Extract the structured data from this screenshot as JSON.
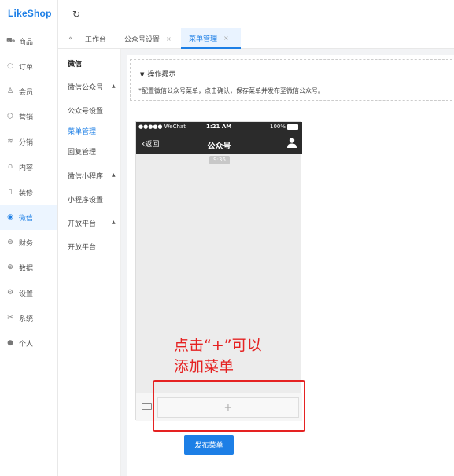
{
  "app": {
    "logo": "LikeShop"
  },
  "sidebar": {
    "items": [
      {
        "label": "商品",
        "icon": "cart-icon"
      },
      {
        "label": "订单",
        "icon": "bell-icon"
      },
      {
        "label": "会员",
        "icon": "user-icon"
      },
      {
        "label": "营销",
        "icon": "cube-icon"
      },
      {
        "label": "分销",
        "icon": "layers-icon"
      },
      {
        "label": "内容",
        "icon": "book-icon"
      },
      {
        "label": "装修",
        "icon": "phone-icon"
      },
      {
        "label": "微信",
        "icon": "wechat-icon",
        "active": true
      },
      {
        "label": "财务",
        "icon": "money-icon"
      },
      {
        "label": "数据",
        "icon": "globe-icon"
      },
      {
        "label": "设置",
        "icon": "gear-icon"
      },
      {
        "label": "系统",
        "icon": "tools-icon"
      },
      {
        "label": "个人",
        "icon": "person-icon"
      }
    ]
  },
  "tabs": {
    "items": [
      {
        "label": "工作台"
      },
      {
        "label": "公众号设置",
        "close": "×"
      },
      {
        "label": "菜单管理",
        "close": "×",
        "active": true
      }
    ]
  },
  "submenu": {
    "title": "微信",
    "group1": "微信公众号",
    "item1": "公众号设置",
    "item2": "菜单管理",
    "item3": "回复管理",
    "group2": "微信小程序",
    "item4": "小程序设置",
    "group3": "开放平台",
    "item5": "开放平台"
  },
  "tip": {
    "title": "操作提示",
    "desc": "*配置微信公众号菜单，点击确认，保存菜单并发布至微信公众号。"
  },
  "phone": {
    "carrier": "●●●●● WeChat",
    "time": "1:21 AM",
    "battery": "100%",
    "back": "返回",
    "title": "公众号",
    "msg_time": "9:36",
    "add": "+"
  },
  "annotation": {
    "line1": "点击“+”可以",
    "line2": "添加菜单"
  },
  "publish_label": "发布菜单",
  "colors": {
    "accent": "#1d7fe6",
    "annotation": "#e52222"
  }
}
